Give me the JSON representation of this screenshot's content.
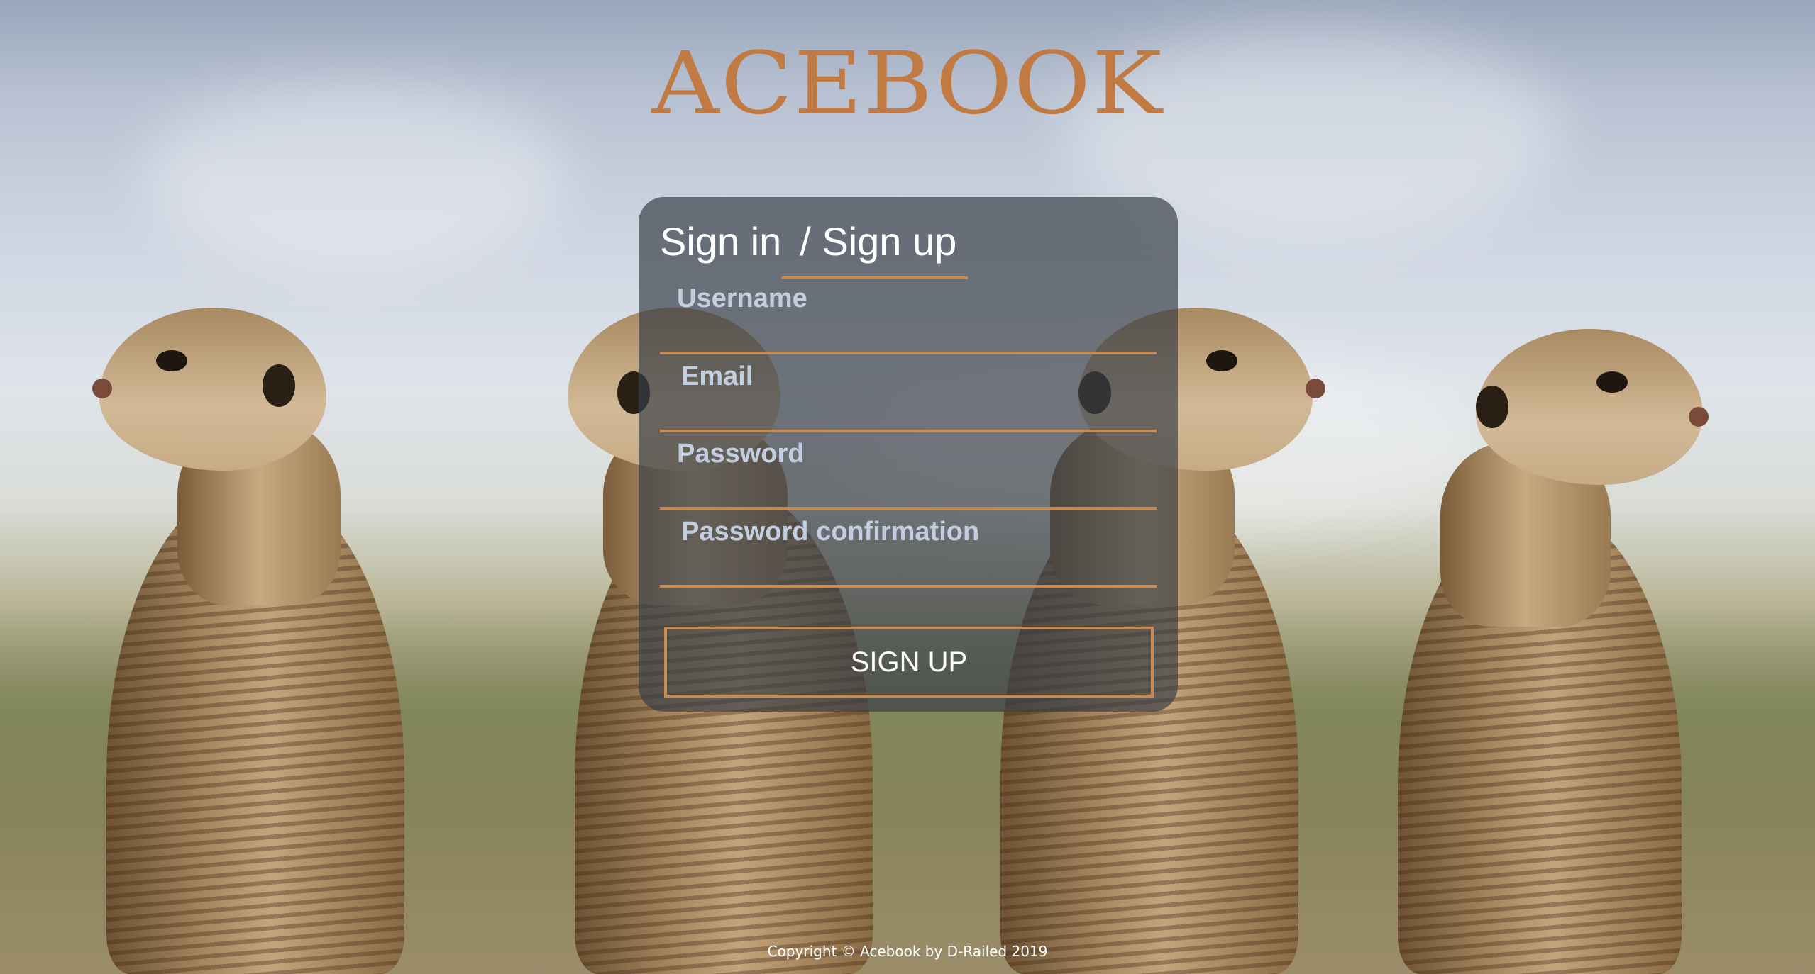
{
  "header": {
    "logo_text": "ACEBOOK"
  },
  "form": {
    "tabs": {
      "sign_in_label": "Sign in",
      "sign_up_label": "/ Sign up",
      "active": "sign_up"
    },
    "fields": {
      "username": {
        "label": "Username",
        "value": ""
      },
      "email": {
        "label": "Email",
        "value": ""
      },
      "password": {
        "label": "Password",
        "value": ""
      },
      "password_confirmation": {
        "label": "Password confirmation",
        "value": ""
      }
    },
    "submit_label": "SIGN UP"
  },
  "footer": {
    "copyright": "Copyright © Acebook by D-Railed 2019"
  },
  "colors": {
    "accent": "#c78a52",
    "logo": "#c07a42",
    "card_background": "rgba(55,60,70,0.68)",
    "label": "#c3cde0"
  },
  "background": {
    "image_subject": "four meerkats standing upright"
  }
}
